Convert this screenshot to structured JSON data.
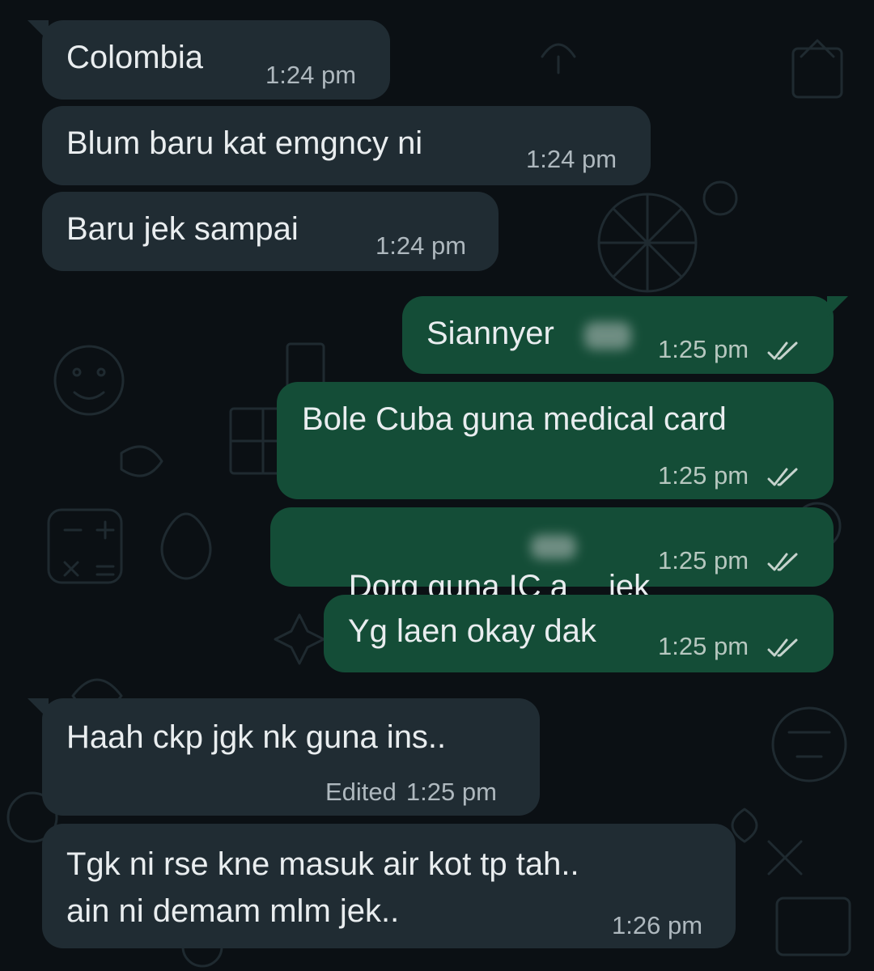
{
  "messages": [
    {
      "direction": "in",
      "text": "Colombia",
      "time": "1:24 pm"
    },
    {
      "direction": "in",
      "text": "Blum baru kat emgncy ni",
      "time": "1:24 pm"
    },
    {
      "direction": "in",
      "text": "Baru jek sampai",
      "time": "1:24 pm"
    },
    {
      "direction": "out",
      "text": "Siannyer",
      "time": "1:25 pm",
      "status": "read"
    },
    {
      "direction": "out",
      "text": "Bole Cuba guna medical card",
      "time": "1:25 pm",
      "status": "read"
    },
    {
      "direction": "out",
      "text_before": "Dorg guna IC a",
      "text_after": "jek",
      "time": "1:25 pm",
      "status": "read"
    },
    {
      "direction": "out",
      "text": "Yg laen okay dak",
      "time": "1:25 pm",
      "status": "read"
    },
    {
      "direction": "in",
      "text": "Haah ckp jgk nk guna ins..",
      "edited_label": "Edited",
      "time": "1:25 pm"
    },
    {
      "direction": "in",
      "lines": [
        "Tgk ni rse kne masuk air kot tp tah..",
        "ain ni demam mlm jek.."
      ],
      "time": "1:26 pm"
    }
  ],
  "colors": {
    "background": "#0b1014",
    "incoming_bubble": "#202c33",
    "outgoing_bubble": "#144d37",
    "message_text": "#e9edef",
    "meta_text": "#aeb8be",
    "read_ticks": "#c6d3cd"
  },
  "icons": {
    "read_receipt": "double-check-icon"
  }
}
